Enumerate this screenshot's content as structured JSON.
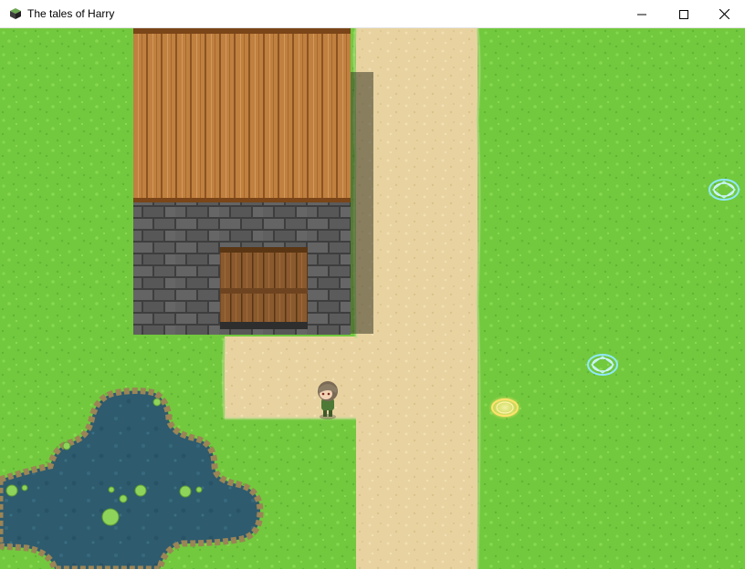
{
  "window": {
    "title": "The tales of Harry",
    "app_icon": "game-cube-icon",
    "controls": [
      "minimize-icon",
      "maximize-icon",
      "close-icon"
    ]
  },
  "scene": {
    "colors": {
      "grass": "#72c93e",
      "path": "#e8d3a0",
      "roof": "#c0803f",
      "wall": "#5a5a5a",
      "door": "#8a5a2e",
      "water": "#2e5b6e",
      "warp_circle_blue": "#8fe8ff",
      "warp_circle_gold": "#ffe36a"
    },
    "objects": [
      "house-with-wooden-roof",
      "wooden-door",
      "pond-with-lily-pads",
      "player-character",
      "warp-circle-blue",
      "warp-circle-blue",
      "warp-circle-gold"
    ]
  }
}
